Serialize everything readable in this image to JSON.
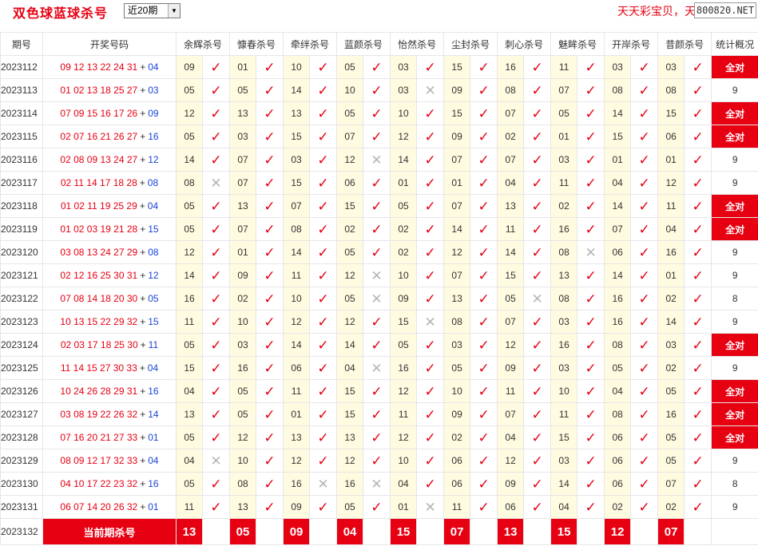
{
  "app_title": "双色球蓝球杀号",
  "period_select": {
    "value": "近20期",
    "options": [
      "近20期"
    ]
  },
  "brand": "天天彩宝贝，天",
  "url_badge": "800820.NET",
  "colors": {
    "accent": "#e60012",
    "blue_ball": "#1a44d8",
    "num_cell_bg": "#fffbe0"
  },
  "columns": {
    "issue": "期号",
    "draw": "开奖号码",
    "experts": [
      "余辉杀号",
      "慷春杀号",
      "牵绊杀号",
      "蓝颜杀号",
      "怡然杀号",
      "尘封杀号",
      "刺心杀号",
      "魅眸杀号",
      "开岸杀号",
      "昔颜杀号"
    ],
    "summary": "统计概况"
  },
  "mark_icons": {
    "ok": "✓",
    "fail": "✕"
  },
  "rows": [
    {
      "issue": "2023112",
      "reds": "09 12 13 22 24 31",
      "plus": "+",
      "blue": "04",
      "picks": [
        "09",
        "01",
        "10",
        "05",
        "03",
        "15",
        "16",
        "11",
        "03",
        "03"
      ],
      "marks": [
        "ok",
        "ok",
        "ok",
        "ok",
        "ok",
        "ok",
        "ok",
        "ok",
        "ok",
        "ok"
      ],
      "summary": "全对",
      "all": true
    },
    {
      "issue": "2023113",
      "reds": "01 02 13 18 25 27",
      "plus": "+",
      "blue": "03",
      "picks": [
        "05",
        "05",
        "14",
        "10",
        "03",
        "09",
        "08",
        "07",
        "08",
        "08"
      ],
      "marks": [
        "ok",
        "ok",
        "ok",
        "ok",
        "fail",
        "ok",
        "ok",
        "ok",
        "ok",
        "ok"
      ],
      "summary": "9",
      "all": false
    },
    {
      "issue": "2023114",
      "reds": "07 09 15 16 17 26",
      "plus": "+",
      "blue": "09",
      "picks": [
        "12",
        "13",
        "13",
        "05",
        "10",
        "15",
        "07",
        "05",
        "14",
        "15"
      ],
      "marks": [
        "ok",
        "ok",
        "ok",
        "ok",
        "ok",
        "ok",
        "ok",
        "ok",
        "ok",
        "ok"
      ],
      "summary": "全对",
      "all": true
    },
    {
      "issue": "2023115",
      "reds": "02 07 16 21 26 27",
      "plus": "+",
      "blue": "16",
      "picks": [
        "05",
        "03",
        "15",
        "07",
        "12",
        "09",
        "02",
        "01",
        "15",
        "06"
      ],
      "marks": [
        "ok",
        "ok",
        "ok",
        "ok",
        "ok",
        "ok",
        "ok",
        "ok",
        "ok",
        "ok"
      ],
      "summary": "全对",
      "all": true
    },
    {
      "issue": "2023116",
      "reds": "02 08 09 13 24 27",
      "plus": "+",
      "blue": "12",
      "picks": [
        "14",
        "07",
        "03",
        "12",
        "14",
        "07",
        "07",
        "03",
        "01",
        "01"
      ],
      "marks": [
        "ok",
        "ok",
        "ok",
        "fail",
        "ok",
        "ok",
        "ok",
        "ok",
        "ok",
        "ok"
      ],
      "summary": "9",
      "all": false
    },
    {
      "issue": "2023117",
      "reds": "02 11 14 17 18 28",
      "plus": "+",
      "blue": "08",
      "picks": [
        "08",
        "07",
        "15",
        "06",
        "01",
        "01",
        "04",
        "11",
        "04",
        "12"
      ],
      "marks": [
        "fail",
        "ok",
        "ok",
        "ok",
        "ok",
        "ok",
        "ok",
        "ok",
        "ok",
        "ok"
      ],
      "summary": "9",
      "all": false
    },
    {
      "issue": "2023118",
      "reds": "01 02 11 19 25 29",
      "plus": "+",
      "blue": "04",
      "picks": [
        "05",
        "13",
        "07",
        "15",
        "05",
        "07",
        "13",
        "02",
        "14",
        "11"
      ],
      "marks": [
        "ok",
        "ok",
        "ok",
        "ok",
        "ok",
        "ok",
        "ok",
        "ok",
        "ok",
        "ok"
      ],
      "summary": "全对",
      "all": true
    },
    {
      "issue": "2023119",
      "reds": "01 02 03 19 21 28",
      "plus": "+",
      "blue": "15",
      "picks": [
        "05",
        "07",
        "08",
        "02",
        "02",
        "14",
        "11",
        "16",
        "07",
        "04"
      ],
      "marks": [
        "ok",
        "ok",
        "ok",
        "ok",
        "ok",
        "ok",
        "ok",
        "ok",
        "ok",
        "ok"
      ],
      "summary": "全对",
      "all": true
    },
    {
      "issue": "2023120",
      "reds": "03 08 13 24 27 29",
      "plus": "+",
      "blue": "08",
      "picks": [
        "12",
        "01",
        "14",
        "05",
        "02",
        "12",
        "14",
        "08",
        "06",
        "16"
      ],
      "marks": [
        "ok",
        "ok",
        "ok",
        "ok",
        "ok",
        "ok",
        "ok",
        "fail",
        "ok",
        "ok"
      ],
      "summary": "9",
      "all": false
    },
    {
      "issue": "2023121",
      "reds": "02 12 16 25 30 31",
      "plus": "+",
      "blue": "12",
      "picks": [
        "14",
        "09",
        "11",
        "12",
        "10",
        "07",
        "15",
        "13",
        "14",
        "01"
      ],
      "marks": [
        "ok",
        "ok",
        "ok",
        "fail",
        "ok",
        "ok",
        "ok",
        "ok",
        "ok",
        "ok"
      ],
      "summary": "9",
      "all": false
    },
    {
      "issue": "2023122",
      "reds": "07 08 14 18 20 30",
      "plus": "+",
      "blue": "05",
      "picks": [
        "16",
        "02",
        "10",
        "05",
        "09",
        "13",
        "05",
        "08",
        "16",
        "02"
      ],
      "marks": [
        "ok",
        "ok",
        "ok",
        "fail",
        "ok",
        "ok",
        "fail",
        "ok",
        "ok",
        "ok"
      ],
      "summary": "8",
      "all": false
    },
    {
      "issue": "2023123",
      "reds": "10 13 15 22 29 32",
      "plus": "+",
      "blue": "15",
      "picks": [
        "11",
        "10",
        "12",
        "12",
        "15",
        "08",
        "07",
        "03",
        "16",
        "14"
      ],
      "marks": [
        "ok",
        "ok",
        "ok",
        "ok",
        "fail",
        "ok",
        "ok",
        "ok",
        "ok",
        "ok"
      ],
      "summary": "9",
      "all": false
    },
    {
      "issue": "2023124",
      "reds": "02 03 17 18 25 30",
      "plus": "+",
      "blue": "11",
      "picks": [
        "05",
        "03",
        "14",
        "14",
        "05",
        "03",
        "12",
        "16",
        "08",
        "03"
      ],
      "marks": [
        "ok",
        "ok",
        "ok",
        "ok",
        "ok",
        "ok",
        "ok",
        "ok",
        "ok",
        "ok"
      ],
      "summary": "全对",
      "all": true
    },
    {
      "issue": "2023125",
      "reds": "11 14 15 27 30 33",
      "plus": "+",
      "blue": "04",
      "picks": [
        "15",
        "16",
        "06",
        "04",
        "16",
        "05",
        "09",
        "03",
        "05",
        "02"
      ],
      "marks": [
        "ok",
        "ok",
        "ok",
        "fail",
        "ok",
        "ok",
        "ok",
        "ok",
        "ok",
        "ok"
      ],
      "summary": "9",
      "all": false
    },
    {
      "issue": "2023126",
      "reds": "10 24 26 28 29 31",
      "plus": "+",
      "blue": "16",
      "picks": [
        "04",
        "05",
        "11",
        "15",
        "12",
        "10",
        "11",
        "10",
        "04",
        "05"
      ],
      "marks": [
        "ok",
        "ok",
        "ok",
        "ok",
        "ok",
        "ok",
        "ok",
        "ok",
        "ok",
        "ok"
      ],
      "summary": "全对",
      "all": true
    },
    {
      "issue": "2023127",
      "reds": "03 08 19 22 26 32",
      "plus": "+",
      "blue": "14",
      "picks": [
        "13",
        "05",
        "01",
        "15",
        "11",
        "09",
        "07",
        "11",
        "08",
        "16"
      ],
      "marks": [
        "ok",
        "ok",
        "ok",
        "ok",
        "ok",
        "ok",
        "ok",
        "ok",
        "ok",
        "ok"
      ],
      "summary": "全对",
      "all": true
    },
    {
      "issue": "2023128",
      "reds": "07 16 20 21 27 33",
      "plus": "+",
      "blue": "01",
      "picks": [
        "05",
        "12",
        "13",
        "13",
        "12",
        "02",
        "04",
        "15",
        "06",
        "05"
      ],
      "marks": [
        "ok",
        "ok",
        "ok",
        "ok",
        "ok",
        "ok",
        "ok",
        "ok",
        "ok",
        "ok"
      ],
      "summary": "全对",
      "all": true
    },
    {
      "issue": "2023129",
      "reds": "08 09 12 17 32 33",
      "plus": "+",
      "blue": "04",
      "picks": [
        "04",
        "10",
        "12",
        "12",
        "10",
        "06",
        "12",
        "03",
        "06",
        "05"
      ],
      "marks": [
        "fail",
        "ok",
        "ok",
        "ok",
        "ok",
        "ok",
        "ok",
        "ok",
        "ok",
        "ok"
      ],
      "summary": "9",
      "all": false
    },
    {
      "issue": "2023130",
      "reds": "04 10 17 22 23 32",
      "plus": "+",
      "blue": "16",
      "picks": [
        "05",
        "08",
        "16",
        "16",
        "04",
        "06",
        "09",
        "14",
        "06",
        "07"
      ],
      "marks": [
        "ok",
        "ok",
        "fail",
        "fail",
        "ok",
        "ok",
        "ok",
        "ok",
        "ok",
        "ok"
      ],
      "summary": "8",
      "all": false
    },
    {
      "issue": "2023131",
      "reds": "06 07 14 20 26 32",
      "plus": "+",
      "blue": "01",
      "picks": [
        "11",
        "13",
        "09",
        "05",
        "01",
        "11",
        "06",
        "04",
        "02",
        "02"
      ],
      "marks": [
        "ok",
        "ok",
        "ok",
        "ok",
        "fail",
        "ok",
        "ok",
        "ok",
        "ok",
        "ok"
      ],
      "summary": "9",
      "all": false
    }
  ],
  "current": {
    "issue": "2023132",
    "label": "当前期杀号",
    "picks": [
      "13",
      "05",
      "09",
      "04",
      "15",
      "07",
      "13",
      "15",
      "12",
      "07"
    ]
  }
}
